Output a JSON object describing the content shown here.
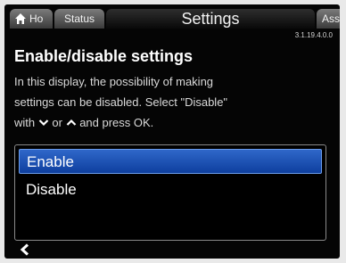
{
  "tabs": {
    "home": "Ho",
    "status": "Status",
    "settings": "Settings",
    "assist": "Assist"
  },
  "version": "3.1.19.4.0.0",
  "title": "Enable/disable settings",
  "description": {
    "line1": "In this display, the possibility of making",
    "line2": "settings can be disabled. Select \"Disable\"",
    "line3_with": "with",
    "line3_or": "or",
    "line3_rest": "and press OK."
  },
  "options": [
    {
      "label": "Enable",
      "selected": true
    },
    {
      "label": "Disable",
      "selected": false
    }
  ],
  "icons": {
    "home": "home-icon",
    "down": "chevron-down-icon",
    "up": "chevron-up-icon",
    "back": "back-arrow-icon"
  },
  "colors": {
    "selection": "#1a4fb5",
    "background": "#050505",
    "text": "#ffffff"
  }
}
